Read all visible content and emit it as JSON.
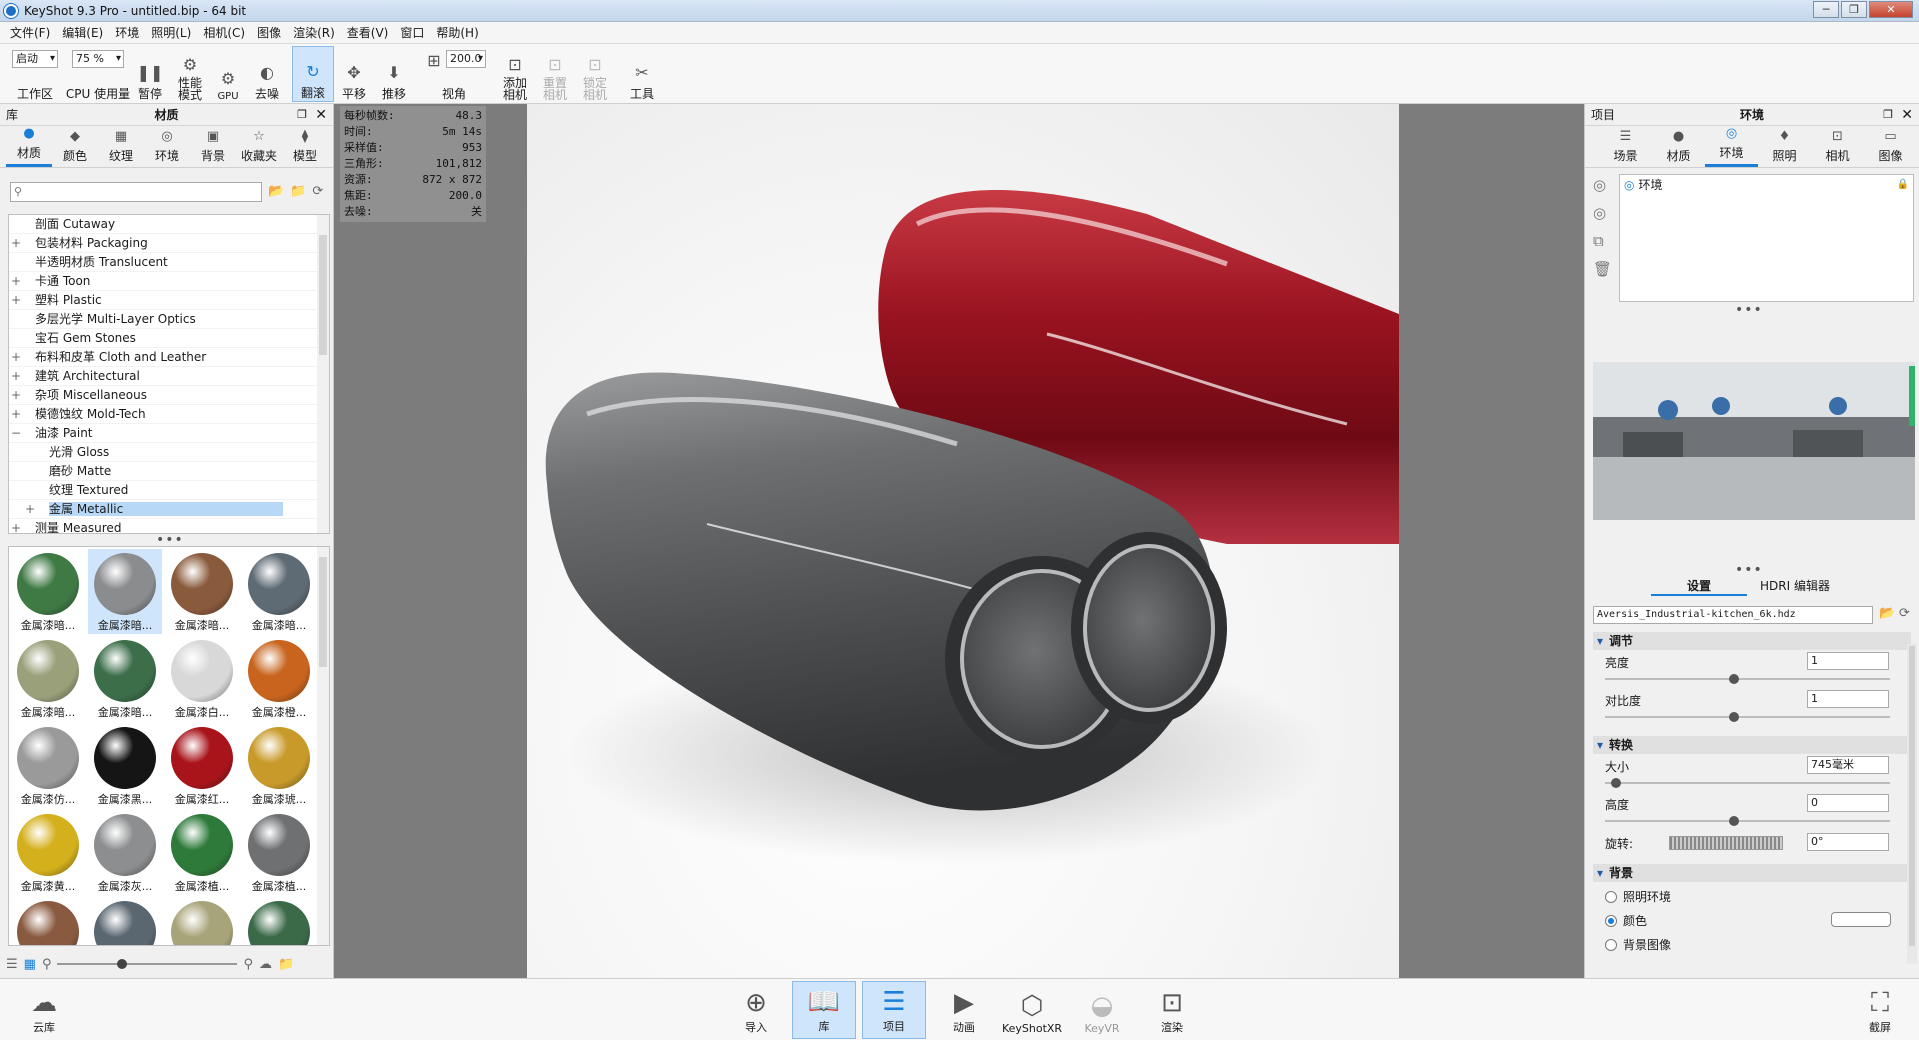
{
  "window": {
    "title": "KeyShot 9.3 Pro  - untitled.bip  - 64 bit",
    "min": "─",
    "max": "❐",
    "close": "✕"
  },
  "menu": [
    "文件(F)",
    "编辑(E)",
    "环境",
    "照明(L)",
    "相机(C)",
    "图像",
    "渲染(R)",
    "查看(V)",
    "窗口",
    "帮助(H)"
  ],
  "toolbar": {
    "workspace_value": "启动",
    "workspace_label": "工作区",
    "cpu_value": "75 %",
    "cpu_label": "CPU 使用量",
    "pause": "暂停",
    "perf": "性能\n模式",
    "gpu": "GPU",
    "denoise": "去噪",
    "tumble": "翻滚",
    "pan": "平移",
    "dolly": "推移",
    "fov_value": "200.0",
    "fov_label": "视角",
    "add_camera": "添加\n相机",
    "reset_camera": "重置\n相机",
    "lock_camera": "锁定\n相机",
    "tools": "工具"
  },
  "library": {
    "panel_left": "库",
    "panel_title": "材质",
    "tabs": [
      "材质",
      "颜色",
      "纹理",
      "环境",
      "背景",
      "收藏夹",
      "模型"
    ],
    "search_placeholder": "",
    "tree": [
      {
        "label": "剖面 Cutaway",
        "exp": "",
        "indent": 1
      },
      {
        "label": "包装材料 Packaging",
        "exp": "+",
        "indent": 1
      },
      {
        "label": "半透明材质 Translucent",
        "exp": "",
        "indent": 1
      },
      {
        "label": "卡通 Toon",
        "exp": "+",
        "indent": 1
      },
      {
        "label": "塑料 Plastic",
        "exp": "+",
        "indent": 1
      },
      {
        "label": "多层光学 Multi-Layer Optics",
        "exp": "",
        "indent": 1
      },
      {
        "label": "宝石 Gem Stones",
        "exp": "",
        "indent": 1
      },
      {
        "label": "布料和皮革 Cloth and Leather",
        "exp": "+",
        "indent": 1
      },
      {
        "label": "建筑 Architectural",
        "exp": "+",
        "indent": 1
      },
      {
        "label": "杂项 Miscellaneous",
        "exp": "+",
        "indent": 1
      },
      {
        "label": "模德蚀纹 Mold-Tech",
        "exp": "+",
        "indent": 1
      },
      {
        "label": "油漆 Paint",
        "exp": "−",
        "indent": 1
      },
      {
        "label": "光滑 Gloss",
        "exp": "",
        "indent": 2
      },
      {
        "label": "磨砂 Matte",
        "exp": "",
        "indent": 2
      },
      {
        "label": "纹理 Textured",
        "exp": "",
        "indent": 2
      },
      {
        "label": "金属 Metallic",
        "exp": "+",
        "indent": 2,
        "selected": true
      },
      {
        "label": "测量 Measured",
        "exp": "+",
        "indent": 1
      }
    ],
    "swatches": [
      {
        "label": "金属漆暗...",
        "color": "#3f7a45"
      },
      {
        "label": "金属漆暗...",
        "color": "#8a8c8e",
        "selected": true
      },
      {
        "label": "金属漆暗...",
        "color": "#8a5a3c"
      },
      {
        "label": "金属漆暗...",
        "color": "#5e6a74"
      },
      {
        "label": "金属漆暗...",
        "color": "#9aa07a"
      },
      {
        "label": "金属漆暗...",
        "color": "#3c6e4a"
      },
      {
        "label": "金属漆白...",
        "color": "#d8d8d8"
      },
      {
        "label": "金属漆橙...",
        "color": "#c8641e"
      },
      {
        "label": "金属漆仿...",
        "color": "#9a9a9a"
      },
      {
        "label": "金属漆黑...",
        "color": "#151515"
      },
      {
        "label": "金属漆红...",
        "color": "#a8141a"
      },
      {
        "label": "金属漆琥...",
        "color": "#c89a2a"
      },
      {
        "label": "金属漆黄...",
        "color": "#d4b01c"
      },
      {
        "label": "金属漆灰...",
        "color": "#8c8e90"
      },
      {
        "label": "金属漆植...",
        "color": "#2e7a3a"
      },
      {
        "label": "金属漆植...",
        "color": "#6e7072"
      },
      {
        "label": "",
        "color": "#8a5a40"
      },
      {
        "label": "",
        "color": "#5a6670"
      },
      {
        "label": "",
        "color": "#a8a47a"
      },
      {
        "label": "",
        "color": "#3a6a48"
      }
    ]
  },
  "stats": [
    {
      "k": "每秒帧数:",
      "v": "48.3"
    },
    {
      "k": "时间:",
      "v": "5m 14s"
    },
    {
      "k": "采样值:",
      "v": "953"
    },
    {
      "k": "三角形:",
      "v": "101,812"
    },
    {
      "k": "资源:",
      "v": "872 x 872"
    },
    {
      "k": "焦距:",
      "v": "200.0"
    },
    {
      "k": "去噪:",
      "v": "关"
    }
  ],
  "project": {
    "panel_left": "项目",
    "panel_title": "环境",
    "tabs": [
      "场景",
      "材质",
      "环境",
      "照明",
      "相机",
      "图像"
    ],
    "env_item": "环境",
    "subtabs": [
      "设置",
      "HDRI 编辑器"
    ],
    "hdri_file": "Aversis_Industrial-kitchen_6k.hdz",
    "sections": {
      "adjust": "调节",
      "transform": "转换",
      "background": "背景"
    },
    "brightness_label": "亮度",
    "brightness_value": "1",
    "brightness_level": 0.45,
    "contrast_label": "对比度",
    "contrast_value": "1",
    "contrast_level": 0.45,
    "size_label": "大小",
    "size_value": "745毫米",
    "size_level": 0.02,
    "height_label": "高度",
    "height_value": "0",
    "height_level": 0.45,
    "rotation_label": "旋转:",
    "rotation_value": "0°",
    "bg_options": [
      "照明环境",
      "颜色",
      "背景图像"
    ],
    "bg_selected": 1
  },
  "bottom": {
    "cloud": "云库",
    "import": "导入",
    "library": "库",
    "project": "项目",
    "animation": "动画",
    "keyshotxr": "KeyShotXR",
    "keyvr": "KeyVR",
    "render": "渲染",
    "screenshot": "截屏"
  }
}
